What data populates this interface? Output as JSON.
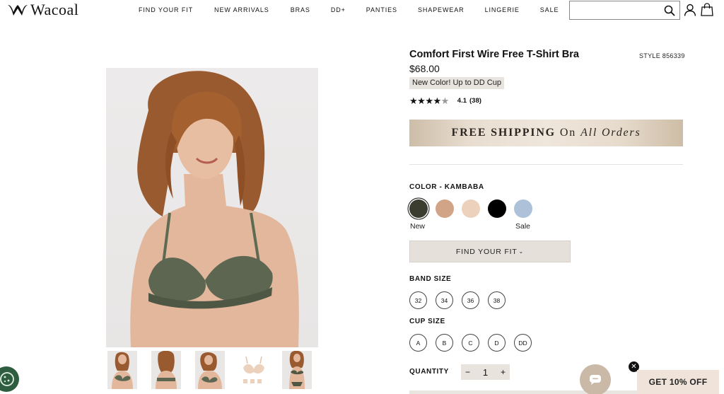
{
  "header": {
    "logo_text": "Wacoal",
    "nav": [
      "FIND YOUR FIT",
      "NEW ARRIVALS",
      "BRAS",
      "DD+",
      "PANTIES",
      "SHAPEWEAR",
      "LINGERIE",
      "SALE"
    ],
    "search": {
      "value": "",
      "placeholder": ""
    },
    "icons": [
      "search-icon",
      "account-icon",
      "shopping-bag-icon"
    ]
  },
  "gallery": {
    "thumbnail_count": 5
  },
  "product": {
    "title": "Comfort First Wire Free T-Shirt Bra",
    "style_number": "STYLE 856339",
    "price": "$68.00",
    "badge": "New Color! Up to DD Cup",
    "rating": {
      "value": 4.1,
      "value_label": "4.1",
      "count_label": "(38)",
      "stars_filled": 4,
      "stars_total": 5
    }
  },
  "shipping_banner": {
    "part1": "FREE SHIPPING",
    "part2": "On",
    "part3": "All Orders"
  },
  "color": {
    "label": "COLOR - KAMBABA",
    "swatches": [
      {
        "name": "Kambaba",
        "hex": "#3b3d31",
        "note": "New",
        "selected": true
      },
      {
        "name": "Rose",
        "hex": "#d2a487",
        "note": "",
        "selected": false
      },
      {
        "name": "Sand",
        "hex": "#ecd2bd",
        "note": "",
        "selected": false
      },
      {
        "name": "Black",
        "hex": "#000000",
        "note": "",
        "selected": false
      },
      {
        "name": "Blue",
        "hex": "#adc2d8",
        "note": "Sale",
        "selected": false
      }
    ]
  },
  "fit_button": {
    "label": "FIND YOUR FIT",
    "chevron": "⌄"
  },
  "band_size": {
    "label": "BAND SIZE",
    "options": [
      "32",
      "34",
      "36",
      "38"
    ]
  },
  "cup_size": {
    "label": "CUP SIZE",
    "options": [
      "A",
      "B",
      "C",
      "D",
      "DD"
    ]
  },
  "quantity": {
    "label": "QUANTITY",
    "value": "1",
    "minus": "−",
    "plus": "+"
  },
  "promo": {
    "label": "GET 10% OFF",
    "close": "✕"
  },
  "colors": {
    "accent_beige": "#e5e0da",
    "text": "#111111",
    "chat_button": "#c9b9a6",
    "cookie_button": "#2e5d3f"
  }
}
